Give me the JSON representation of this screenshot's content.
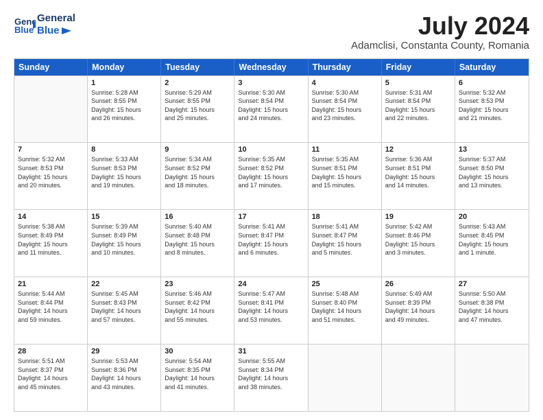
{
  "header": {
    "logo_line1": "General",
    "logo_line2": "Blue",
    "month": "July 2024",
    "location": "Adamclisi, Constanta County, Romania"
  },
  "weekdays": [
    "Sunday",
    "Monday",
    "Tuesday",
    "Wednesday",
    "Thursday",
    "Friday",
    "Saturday"
  ],
  "rows": [
    [
      {
        "day": "",
        "text": ""
      },
      {
        "day": "1",
        "text": "Sunrise: 5:28 AM\nSunset: 8:55 PM\nDaylight: 15 hours\nand 26 minutes."
      },
      {
        "day": "2",
        "text": "Sunrise: 5:29 AM\nSunset: 8:55 PM\nDaylight: 15 hours\nand 25 minutes."
      },
      {
        "day": "3",
        "text": "Sunrise: 5:30 AM\nSunset: 8:54 PM\nDaylight: 15 hours\nand 24 minutes."
      },
      {
        "day": "4",
        "text": "Sunrise: 5:30 AM\nSunset: 8:54 PM\nDaylight: 15 hours\nand 23 minutes."
      },
      {
        "day": "5",
        "text": "Sunrise: 5:31 AM\nSunset: 8:54 PM\nDaylight: 15 hours\nand 22 minutes."
      },
      {
        "day": "6",
        "text": "Sunrise: 5:32 AM\nSunset: 8:53 PM\nDaylight: 15 hours\nand 21 minutes."
      }
    ],
    [
      {
        "day": "7",
        "text": "Sunrise: 5:32 AM\nSunset: 8:53 PM\nDaylight: 15 hours\nand 20 minutes."
      },
      {
        "day": "8",
        "text": "Sunrise: 5:33 AM\nSunset: 8:53 PM\nDaylight: 15 hours\nand 19 minutes."
      },
      {
        "day": "9",
        "text": "Sunrise: 5:34 AM\nSunset: 8:52 PM\nDaylight: 15 hours\nand 18 minutes."
      },
      {
        "day": "10",
        "text": "Sunrise: 5:35 AM\nSunset: 8:52 PM\nDaylight: 15 hours\nand 17 minutes."
      },
      {
        "day": "11",
        "text": "Sunrise: 5:35 AM\nSunset: 8:51 PM\nDaylight: 15 hours\nand 15 minutes."
      },
      {
        "day": "12",
        "text": "Sunrise: 5:36 AM\nSunset: 8:51 PM\nDaylight: 15 hours\nand 14 minutes."
      },
      {
        "day": "13",
        "text": "Sunrise: 5:37 AM\nSunset: 8:50 PM\nDaylight: 15 hours\nand 13 minutes."
      }
    ],
    [
      {
        "day": "14",
        "text": "Sunrise: 5:38 AM\nSunset: 8:49 PM\nDaylight: 15 hours\nand 11 minutes."
      },
      {
        "day": "15",
        "text": "Sunrise: 5:39 AM\nSunset: 8:49 PM\nDaylight: 15 hours\nand 10 minutes."
      },
      {
        "day": "16",
        "text": "Sunrise: 5:40 AM\nSunset: 8:48 PM\nDaylight: 15 hours\nand 8 minutes."
      },
      {
        "day": "17",
        "text": "Sunrise: 5:41 AM\nSunset: 8:47 PM\nDaylight: 15 hours\nand 6 minutes."
      },
      {
        "day": "18",
        "text": "Sunrise: 5:41 AM\nSunset: 8:47 PM\nDaylight: 15 hours\nand 5 minutes."
      },
      {
        "day": "19",
        "text": "Sunrise: 5:42 AM\nSunset: 8:46 PM\nDaylight: 15 hours\nand 3 minutes."
      },
      {
        "day": "20",
        "text": "Sunrise: 5:43 AM\nSunset: 8:45 PM\nDaylight: 15 hours\nand 1 minute."
      }
    ],
    [
      {
        "day": "21",
        "text": "Sunrise: 5:44 AM\nSunset: 8:44 PM\nDaylight: 14 hours\nand 59 minutes."
      },
      {
        "day": "22",
        "text": "Sunrise: 5:45 AM\nSunset: 8:43 PM\nDaylight: 14 hours\nand 57 minutes."
      },
      {
        "day": "23",
        "text": "Sunrise: 5:46 AM\nSunset: 8:42 PM\nDaylight: 14 hours\nand 55 minutes."
      },
      {
        "day": "24",
        "text": "Sunrise: 5:47 AM\nSunset: 8:41 PM\nDaylight: 14 hours\nand 53 minutes."
      },
      {
        "day": "25",
        "text": "Sunrise: 5:48 AM\nSunset: 8:40 PM\nDaylight: 14 hours\nand 51 minutes."
      },
      {
        "day": "26",
        "text": "Sunrise: 5:49 AM\nSunset: 8:39 PM\nDaylight: 14 hours\nand 49 minutes."
      },
      {
        "day": "27",
        "text": "Sunrise: 5:50 AM\nSunset: 8:38 PM\nDaylight: 14 hours\nand 47 minutes."
      }
    ],
    [
      {
        "day": "28",
        "text": "Sunrise: 5:51 AM\nSunset: 8:37 PM\nDaylight: 14 hours\nand 45 minutes."
      },
      {
        "day": "29",
        "text": "Sunrise: 5:53 AM\nSunset: 8:36 PM\nDaylight: 14 hours\nand 43 minutes."
      },
      {
        "day": "30",
        "text": "Sunrise: 5:54 AM\nSunset: 8:35 PM\nDaylight: 14 hours\nand 41 minutes."
      },
      {
        "day": "31",
        "text": "Sunrise: 5:55 AM\nSunset: 8:34 PM\nDaylight: 14 hours\nand 38 minutes."
      },
      {
        "day": "",
        "text": ""
      },
      {
        "day": "",
        "text": ""
      },
      {
        "day": "",
        "text": ""
      }
    ]
  ]
}
